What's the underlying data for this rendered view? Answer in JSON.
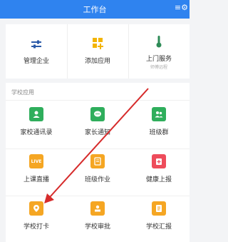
{
  "header": {
    "title": "工作台",
    "menu_icon": "≡⚙"
  },
  "top_actions": [
    {
      "label": "管理企业",
      "icon": "sliders-icon",
      "color": "#2b5aa8"
    },
    {
      "label": "添加应用",
      "icon": "add-apps-icon",
      "color": "#f3b400"
    },
    {
      "label": "上门服务",
      "sub": "师傅远程",
      "icon": "thermometer-icon",
      "color": "#2e8b57"
    }
  ],
  "section": {
    "title": "学校应用"
  },
  "apps": [
    {
      "label": "家校通讯录",
      "icon": "contacts-icon",
      "color": "#2fae5c",
      "glyph": "👤"
    },
    {
      "label": "家长通知",
      "icon": "chat-icon",
      "color": "#2fae5c",
      "glyph": "💬"
    },
    {
      "label": "班级群",
      "icon": "group-icon",
      "color": "#2fae5c",
      "glyph": "👥"
    },
    {
      "label": "上课直播",
      "icon": "live-icon",
      "color": "#f5a623",
      "glyph": "LIVE"
    },
    {
      "label": "班级作业",
      "icon": "homework-icon",
      "color": "#f5a623",
      "glyph": "✎"
    },
    {
      "label": "健康上报",
      "icon": "health-report-icon",
      "color": "#ee4c5b",
      "glyph": "+"
    },
    {
      "label": "学校打卡",
      "icon": "location-pin-icon",
      "color": "#f5a623",
      "glyph": "◉"
    },
    {
      "label": "学校审批",
      "icon": "approval-icon",
      "color": "#f5a623",
      "glyph": "▤"
    },
    {
      "label": "学校汇报",
      "icon": "report-icon",
      "color": "#f5a623",
      "glyph": "☰"
    }
  ],
  "colors": {
    "header_bg": "#2f83ef",
    "arrow": "#d62b2b"
  }
}
